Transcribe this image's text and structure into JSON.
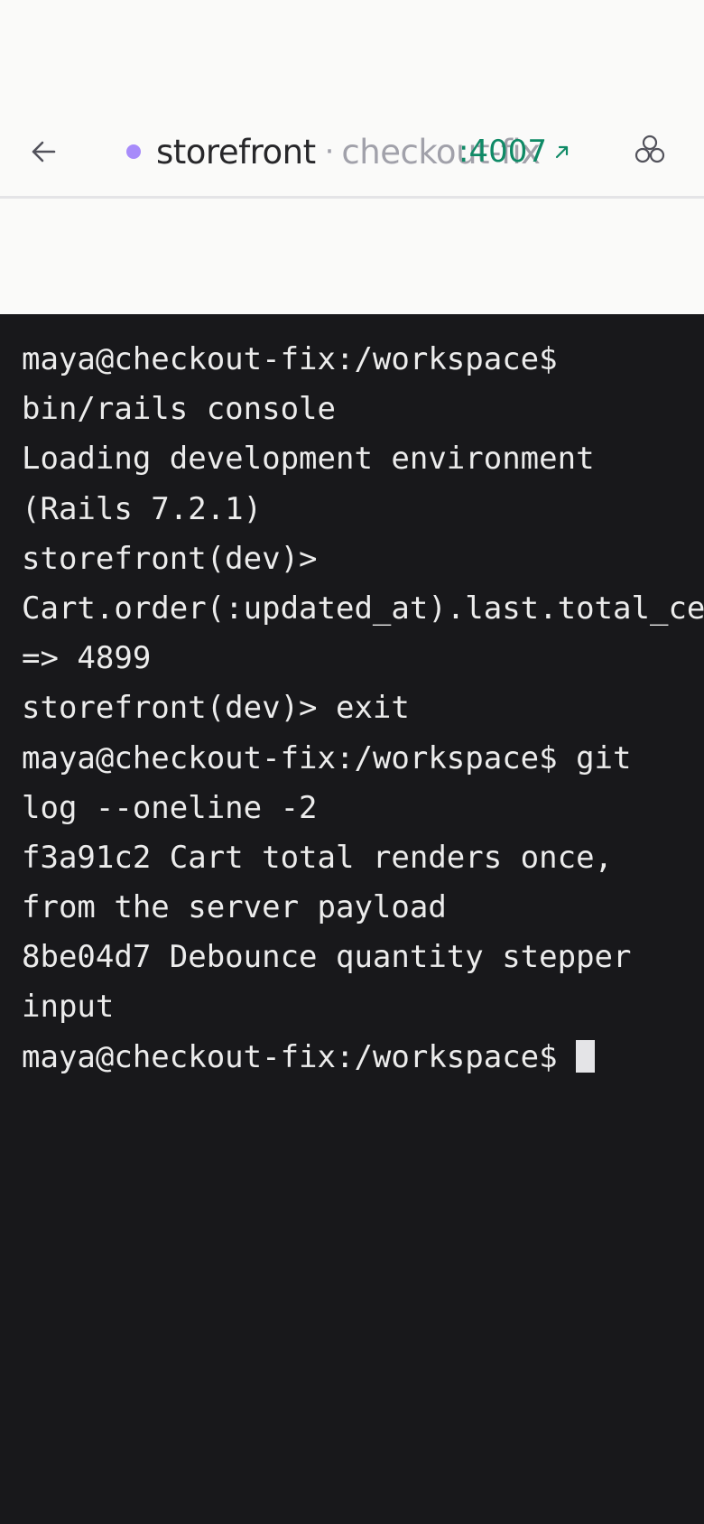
{
  "header": {
    "project": "storefront",
    "separator": "·",
    "branch": "checkout-fix",
    "port_label": ":4007",
    "status_dot_color": "#a78bfa",
    "back_icon": "arrow-left-icon",
    "open_icon": "arrow-up-right-icon",
    "share_icon": "share-icon"
  },
  "terminal": {
    "lines": [
      "maya@checkout-fix:/workspace$",
      "bin/rails console",
      "Loading development environment",
      "(Rails 7.2.1)",
      "storefront(dev)>",
      "Cart.order(:updated_at).last.total_cents",
      "=> 4899",
      "storefront(dev)> exit",
      "maya@checkout-fix:/workspace$ git",
      "log --oneline -2",
      "f3a91c2 Cart total renders once,",
      "from the server payload",
      "8be04d7 Debounce quantity stepper",
      "input"
    ],
    "prompt": "maya@checkout-fix:/workspace$ "
  },
  "colors": {
    "terminal_bg": "#18181b",
    "terminal_fg": "#ececec",
    "port_accent": "#0f8a66"
  }
}
